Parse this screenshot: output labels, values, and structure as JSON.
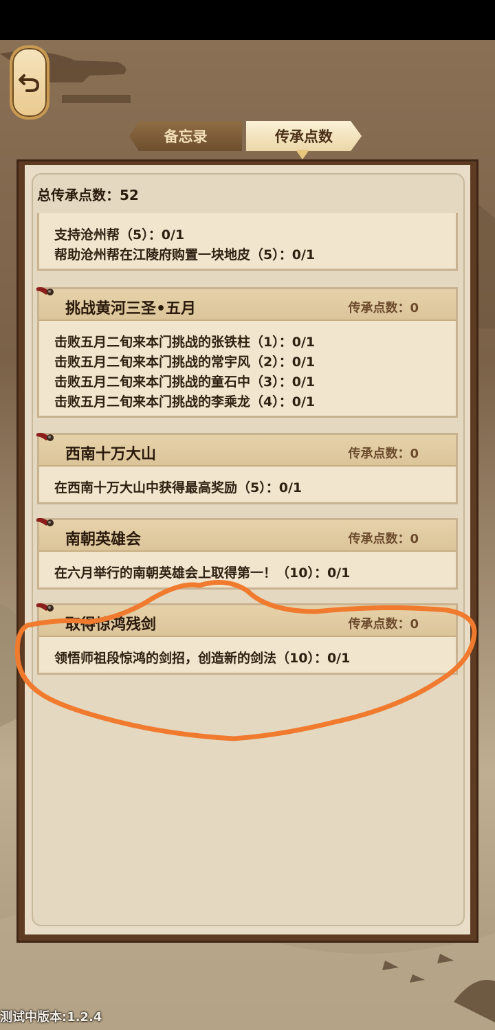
{
  "tabs": {
    "memo": "备忘录",
    "inheritance": "传承点数"
  },
  "summary": {
    "label": "总传承点数：",
    "value": "52"
  },
  "cards": [
    {
      "title": "",
      "points_label": "",
      "points_value": "",
      "lines": [
        "支持沧州帮（5）：0/1",
        "帮助沧州帮在江陵府购置一块地皮（5）：0/1"
      ]
    },
    {
      "title": "挑战黄河三圣•五月",
      "points_label": "传承点数：",
      "points_value": "0",
      "lines": [
        "击败五月二旬来本门挑战的张铁柱（1）：0/1",
        "击败五月二旬来本门挑战的常宇风（2）：0/1",
        "击败五月二旬来本门挑战的童石中（3）：0/1",
        "击败五月二旬来本门挑战的李乘龙（4）：0/1"
      ]
    },
    {
      "title": "西南十万大山",
      "points_label": "传承点数：",
      "points_value": "0",
      "lines": [
        "在西南十万大山中获得最高奖励（5）：0/1"
      ]
    },
    {
      "title": "南朝英雄会",
      "points_label": "传承点数：",
      "points_value": "0",
      "lines": [
        "在六月举行的南朝英雄会上取得第一！（10）：0/1"
      ]
    },
    {
      "title": "取得惊鸿残剑",
      "points_label": "传承点数：",
      "points_value": "0",
      "lines": [
        "领悟师祖段惊鸿的剑招，创造新的剑法（10）：0/1"
      ]
    }
  ],
  "footer": {
    "version": "测试中版本:1.2.4"
  },
  "colors": {
    "annotation": "#f07a2e",
    "panel_frame": "#5e3b23",
    "paper": "#e4d8c1"
  },
  "icons": {
    "back": "back-arrow-icon",
    "pin": "pin-icon"
  }
}
